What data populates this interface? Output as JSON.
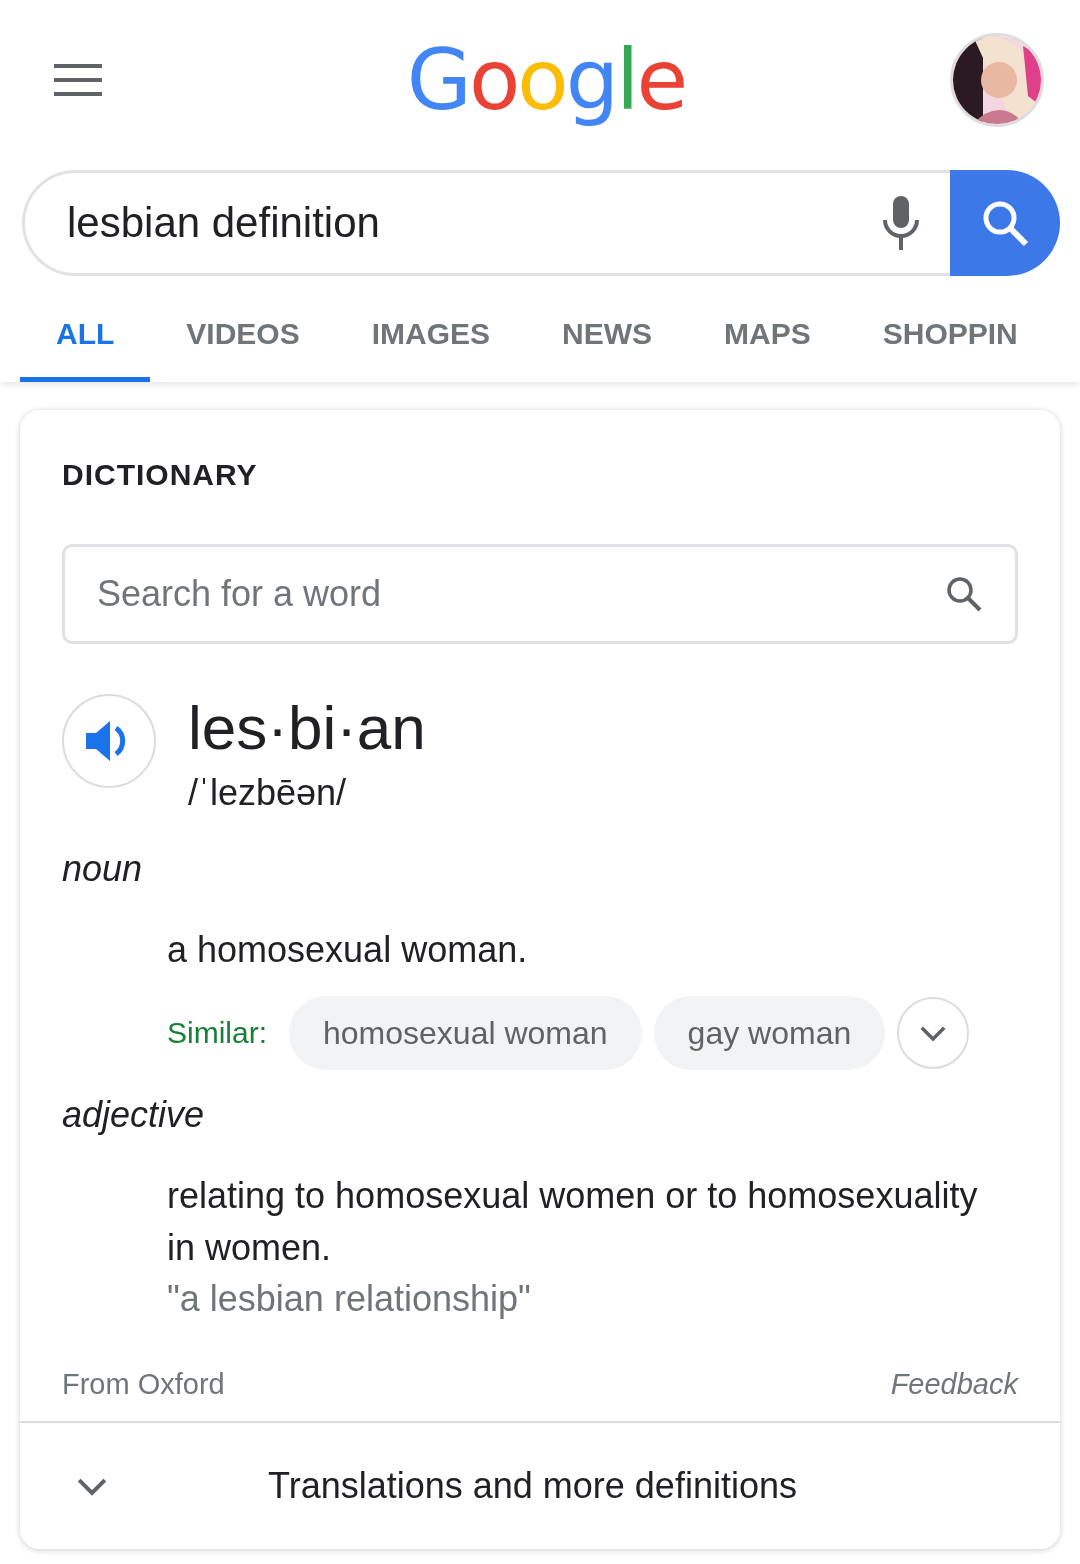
{
  "header": {
    "logo": "Google"
  },
  "search": {
    "value": "lesbian definition"
  },
  "tabs": [
    {
      "label": "ALL",
      "selected": true
    },
    {
      "label": "VIDEOS",
      "selected": false
    },
    {
      "label": "IMAGES",
      "selected": false
    },
    {
      "label": "NEWS",
      "selected": false
    },
    {
      "label": "MAPS",
      "selected": false
    },
    {
      "label": "SHOPPIN",
      "selected": false
    }
  ],
  "dictionary": {
    "heading": "DICTIONARY",
    "search_placeholder": "Search for a word",
    "word": "les·bi·an",
    "pronunciation": "/ˈlezbēən/",
    "senses": [
      {
        "part_of_speech": "noun",
        "definition": "a homosexual woman.",
        "similar_label": "Similar:",
        "similar": [
          "homosexual woman",
          "gay woman"
        ]
      },
      {
        "part_of_speech": "adjective",
        "definition": "relating to homosexual women or to homosexuality in women.",
        "example": "\"a lesbian relationship\""
      }
    ],
    "source": "From Oxford",
    "feedback": "Feedback",
    "more": "Translations and more definitions"
  }
}
